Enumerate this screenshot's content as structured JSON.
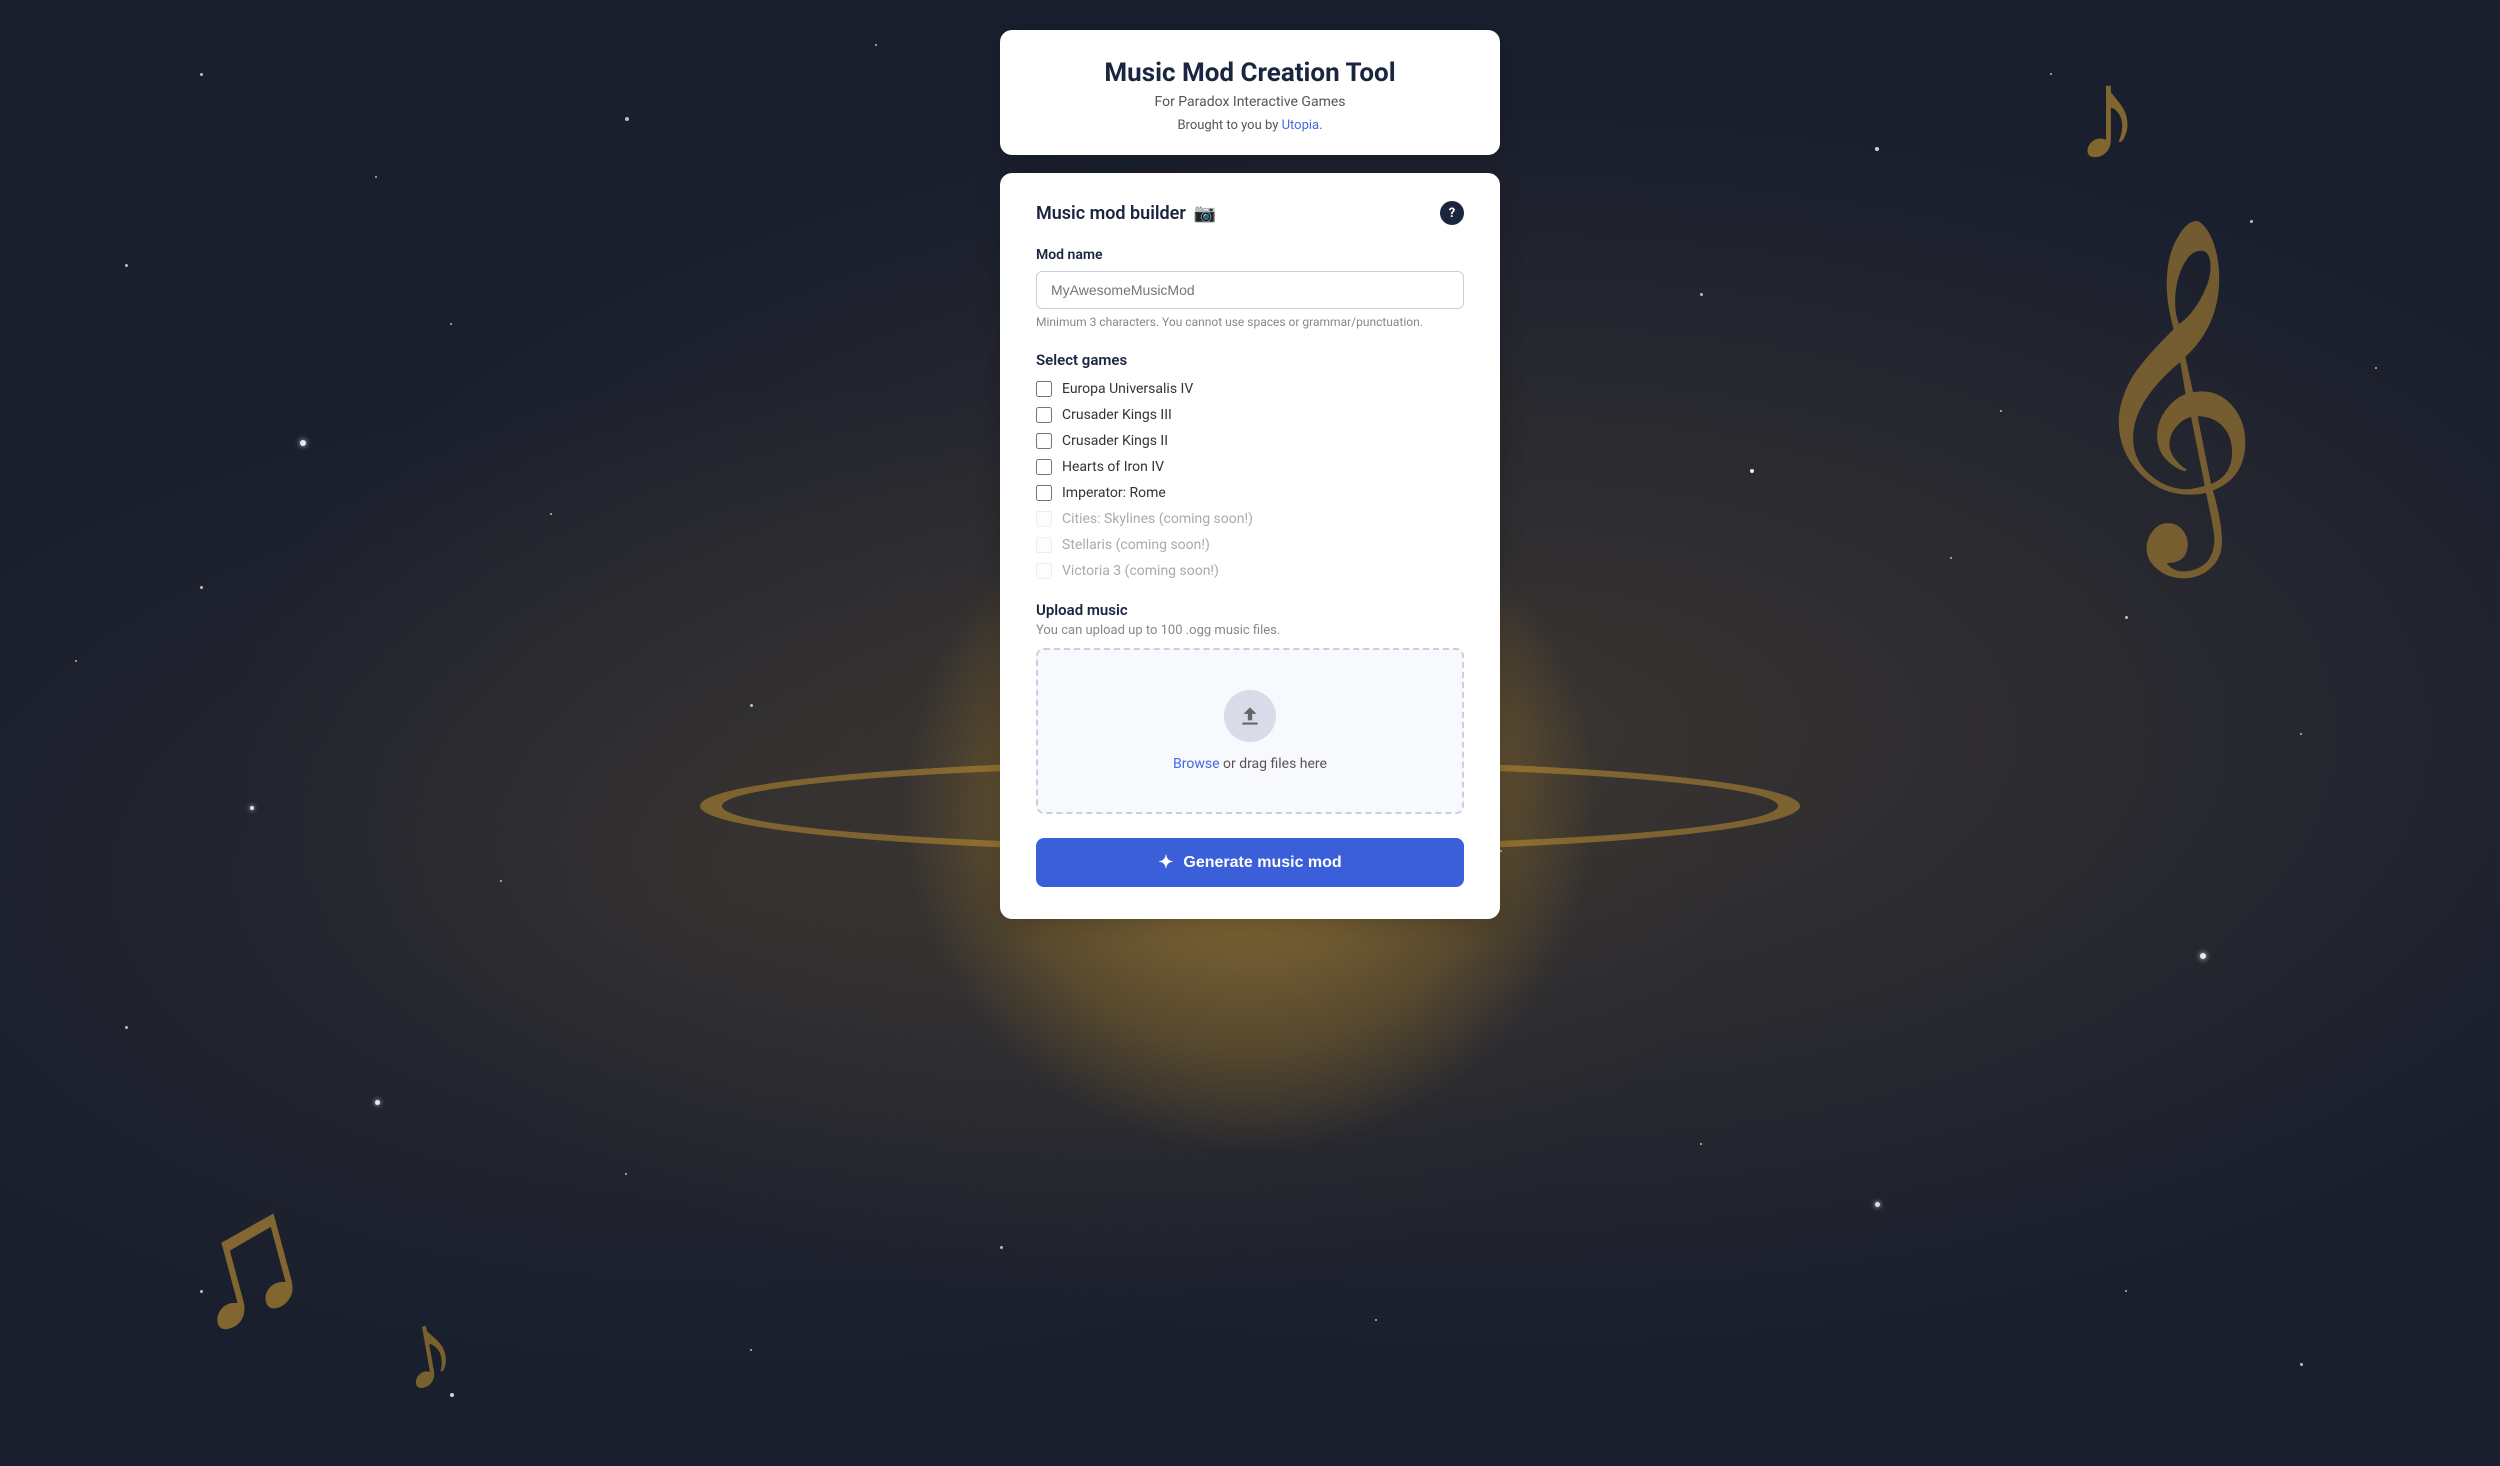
{
  "background": {
    "color": "#1a1f2e"
  },
  "header": {
    "title": "Music Mod Creation Tool",
    "subtitle": "For Paradox Interactive Games",
    "credit_prefix": "Brought to you by ",
    "credit_link_text": "Utopia",
    "credit_suffix": "."
  },
  "builder": {
    "title": "Music mod builder",
    "camera_icon": "📷",
    "help_icon": "?",
    "mod_name_section": {
      "label": "Mod name",
      "placeholder": "MyAwesomeMusicMod",
      "hint": "Minimum 3 characters. You cannot use spaces or grammar/punctuation."
    },
    "games_section": {
      "title": "Select games",
      "games": [
        {
          "label": "Europa Universalis IV",
          "disabled": false,
          "coming_soon": false
        },
        {
          "label": "Crusader Kings III",
          "disabled": false,
          "coming_soon": false
        },
        {
          "label": "Crusader Kings II",
          "disabled": false,
          "coming_soon": false
        },
        {
          "label": "Hearts of Iron IV",
          "disabled": false,
          "coming_soon": false
        },
        {
          "label": "Imperator: Rome",
          "disabled": false,
          "coming_soon": false
        },
        {
          "label": "Cities: Skylines (coming soon!)",
          "disabled": true,
          "coming_soon": true
        },
        {
          "label": "Stellaris (coming soon!)",
          "disabled": true,
          "coming_soon": true
        },
        {
          "label": "Victoria 3 (coming soon!)",
          "disabled": true,
          "coming_soon": true
        }
      ]
    },
    "upload_section": {
      "title": "Upload music",
      "hint": "You can upload up to 100 .ogg music files.",
      "browse_text": "Browse",
      "drag_text": " or drag files here"
    },
    "generate_button": {
      "label": "Generate music mod",
      "icon": "✦"
    }
  }
}
